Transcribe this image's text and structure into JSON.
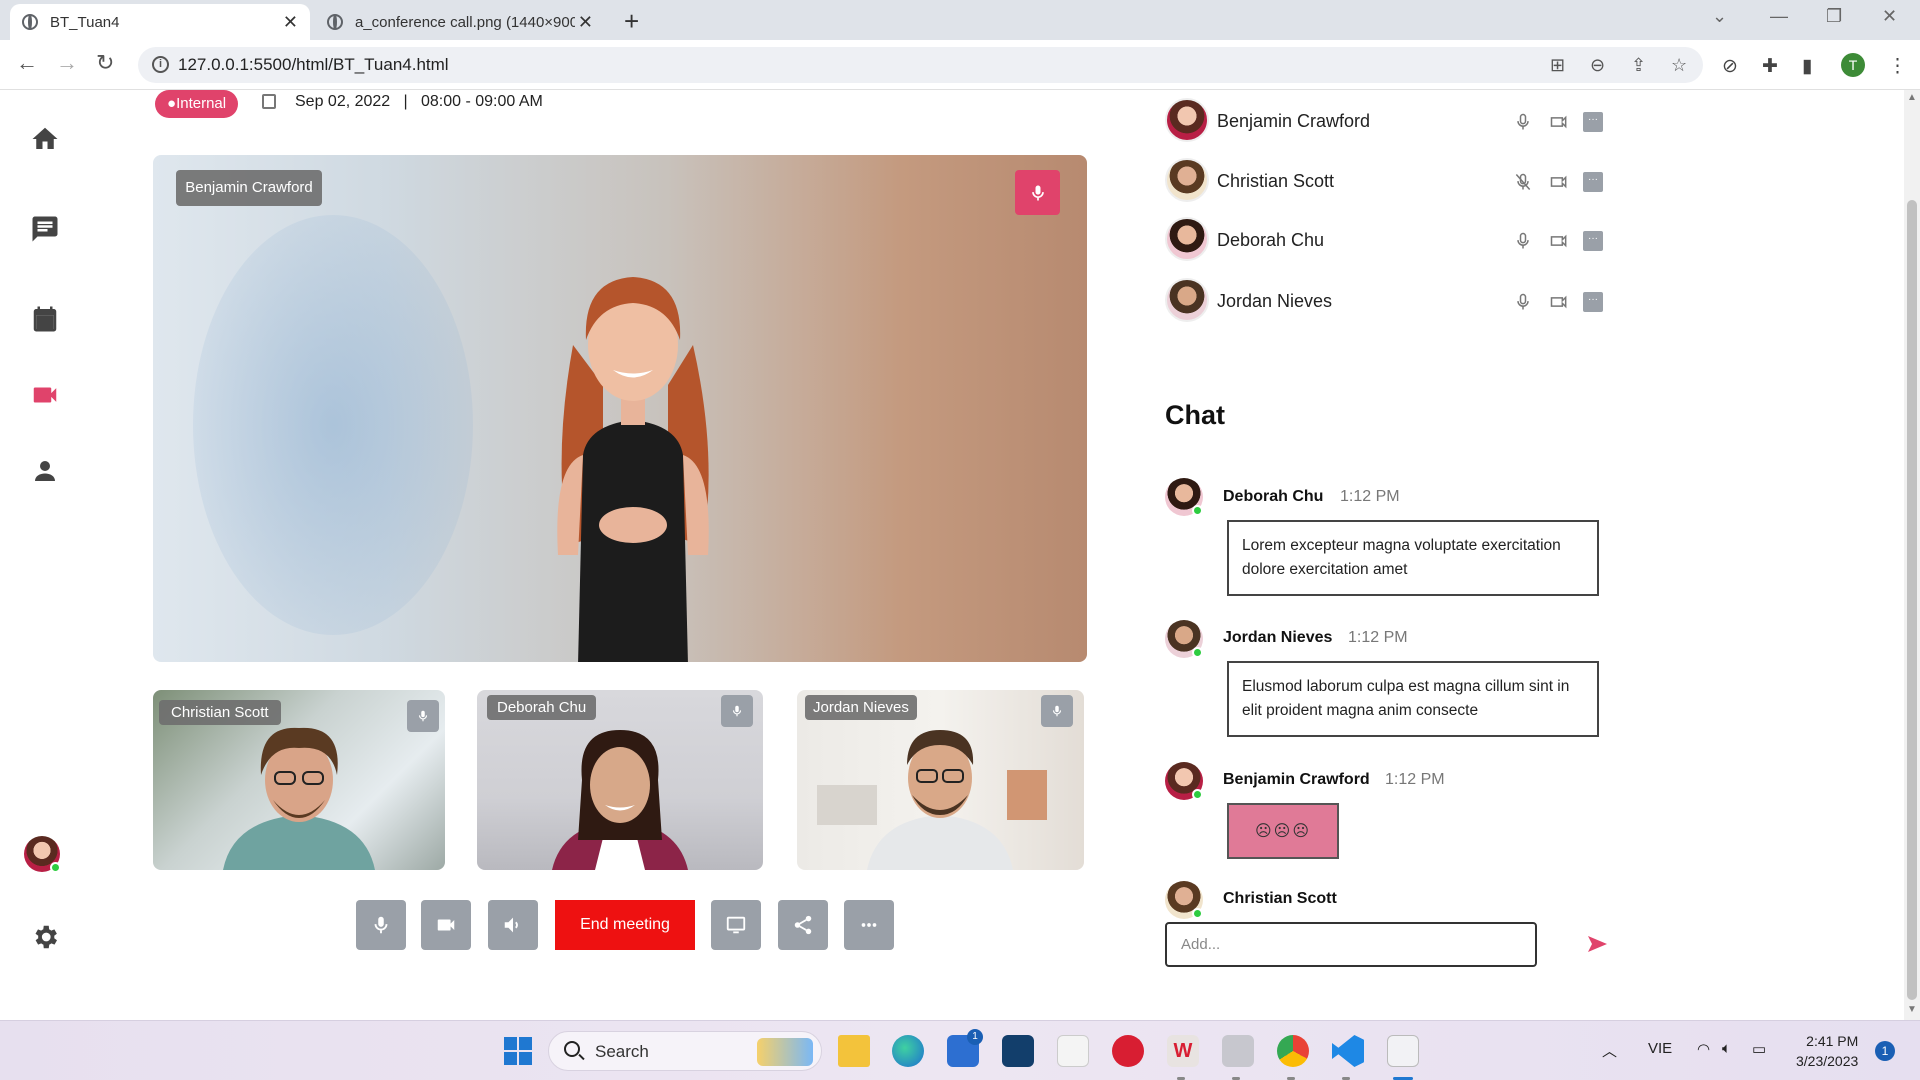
{
  "browser": {
    "tabs": [
      {
        "title": "BT_Tuan4",
        "active": true
      },
      {
        "title": "a_conference call.png (1440×900)",
        "active": false
      }
    ],
    "url": "127.0.0.1:5500/html/BT_Tuan4.html",
    "profile_initial": "T"
  },
  "meeting": {
    "badge": "Internal",
    "date": "Sep 02, 2022",
    "separator": "|",
    "time": "08:00 - 09:00 AM",
    "main_speaker": "Benjamin Crawford",
    "thumbnails": [
      {
        "name": "Christian Scott"
      },
      {
        "name": "Deborah Chu"
      },
      {
        "name": "Jordan Nieves"
      }
    ],
    "end_label": "End meeting"
  },
  "participants": [
    {
      "name": "Benjamin Crawford",
      "mic_muted": false
    },
    {
      "name": "Christian Scott",
      "mic_muted": true
    },
    {
      "name": "Deborah Chu",
      "mic_muted": false
    },
    {
      "name": "Jordan Nieves",
      "mic_muted": false
    }
  ],
  "chat": {
    "title": "Chat",
    "messages": [
      {
        "name": "Deborah Chu",
        "time": "1:12 PM",
        "text": "Lorem excepteur magna voluptate exercitation dolore exercitation amet"
      },
      {
        "name": "Jordan Nieves",
        "time": "1:12 PM",
        "text": "Elusmod laborum culpa est magna cillum sint in elit proident magna anim consecte"
      },
      {
        "name": "Benjamin Crawford",
        "time": "1:12 PM",
        "text": "☹☹☹"
      }
    ],
    "typing_user": "Christian Scott",
    "input_placeholder": "Add..."
  },
  "colors": {
    "accent": "#e0436b",
    "end_button": "#ee1111",
    "control_button": "#9aa0a8",
    "online": "#2ecc40"
  },
  "taskbar": {
    "search_label": "Search",
    "language": "VIE",
    "time": "2:41 PM",
    "date": "3/23/2023",
    "notification_count": "1",
    "store_badge": "1"
  }
}
